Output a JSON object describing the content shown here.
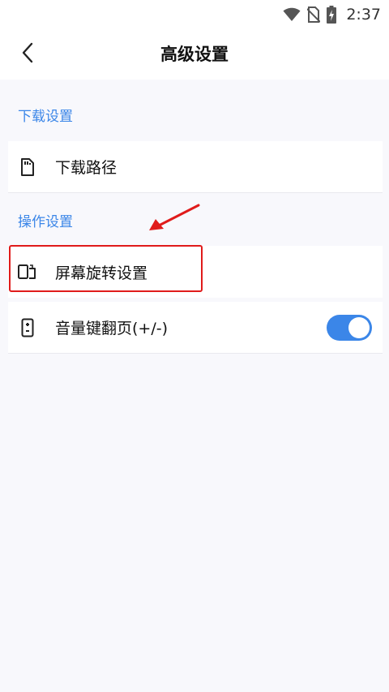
{
  "status_bar": {
    "time": "2:37",
    "icons": [
      "wifi-icon",
      "no-sim-icon",
      "battery-charging-icon"
    ]
  },
  "header": {
    "title": "高级设置",
    "back_icon": "chevron-left-icon"
  },
  "sections": [
    {
      "title": "下载设置",
      "items": [
        {
          "label": "下载路径",
          "icon": "sd-card-icon"
        }
      ]
    },
    {
      "title": "操作设置",
      "items": [
        {
          "label": "屏幕旋转设置",
          "icon": "screen-rotation-icon"
        },
        {
          "label": "音量键翻页(+/-)",
          "icon": "volume-key-icon",
          "toggle": true
        }
      ]
    }
  ],
  "colors": {
    "accent": "#3b86e8",
    "highlight": "#e01b1b",
    "background": "#f8f8fc"
  }
}
